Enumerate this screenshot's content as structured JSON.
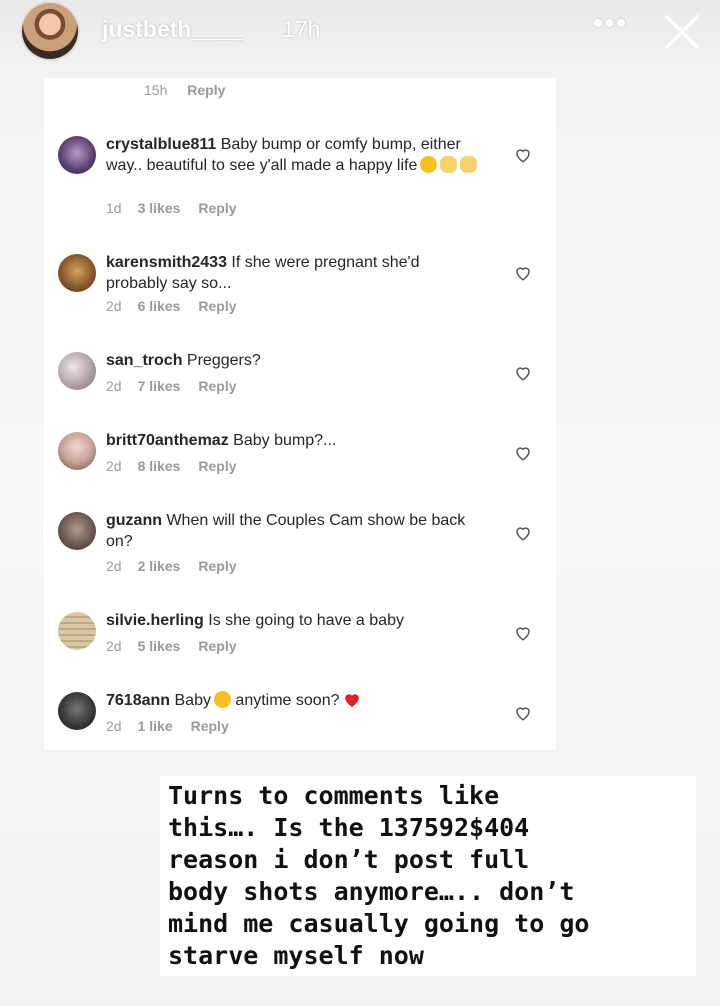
{
  "story": {
    "username": "justbeth____",
    "time": "17h",
    "more_icon": "more-icon",
    "close_icon": "close-icon"
  },
  "partial_comment": {
    "time": "15h",
    "reply": "Reply"
  },
  "comments": [
    {
      "user": "crystalblue811",
      "text": "Baby bump or comfy bump, either way.. beautiful to see y'all made a happy life",
      "time": "1d",
      "likes": "3 likes",
      "reply": "Reply",
      "avatar_color": "#6b4f7d"
    },
    {
      "user": "karensmith2433",
      "text": "If she were pregnant she'd probably say so...",
      "time": "2d",
      "likes": "6 likes",
      "reply": "Reply",
      "avatar_color": "#8a5a2e"
    },
    {
      "user": "san_troch",
      "text": "Preggers?",
      "time": "2d",
      "likes": "7 likes",
      "reply": "Reply",
      "avatar_color": "#b9a7ad"
    },
    {
      "user": "britt70anthemaz",
      "text": "Baby bump?...",
      "time": "2d",
      "likes": "8 likes",
      "reply": "Reply",
      "avatar_color": "#c9a49a"
    },
    {
      "user": "guzann",
      "text": "When will the Couples Cam show be back on?",
      "time": "2d",
      "likes": "2 likes",
      "reply": "Reply",
      "avatar_color": "#6d5a52"
    },
    {
      "user": "silvie.herling",
      "text": "Is she going to have a baby",
      "time": "2d",
      "likes": "5 likes",
      "reply": "Reply",
      "avatar_color": "#cdbb98"
    },
    {
      "user": "7618ann",
      "text_before": "Baby",
      "text_after": "anytime soon?",
      "time": "2d",
      "likes": "1 like",
      "reply": "Reply",
      "avatar_color": "#3a3a3a"
    }
  ],
  "caption": "Turns to comments like\nthis…. Is the 137592$404\nreason i don’t post full\nbody shots anymore….. don’t\nmind me casually going to go\nstarve myself now",
  "colors": {
    "heart_red": "#e0232b",
    "meta_gray": "#9a9a9a",
    "text": "#262626"
  }
}
